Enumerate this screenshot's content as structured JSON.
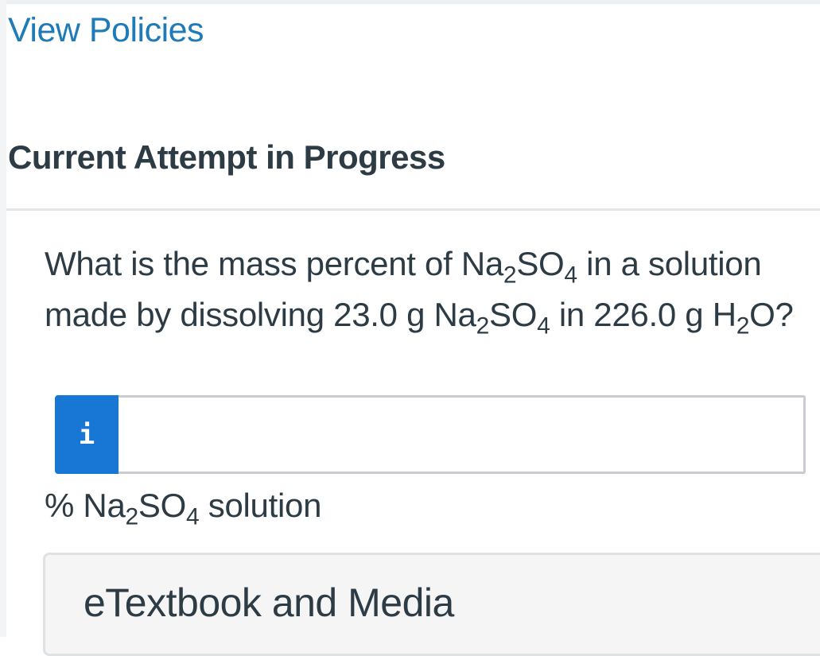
{
  "header": {
    "policies_link": "View Policies",
    "attempt_heading": "Current Attempt in Progress"
  },
  "question": {
    "part1": "What is the mass percent of Na",
    "sub1": "2",
    "part2": "SO",
    "sub2": "4",
    "part3": " in a solution made by dissolving 23.0 g Na",
    "sub3": "2",
    "part4": "SO",
    "sub4": "4",
    "part5": " in 226.0 g H",
    "sub5": "2",
    "part6": "O?"
  },
  "answer": {
    "info_glyph": "i",
    "value": "",
    "placeholder": ""
  },
  "units": {
    "part1": "% Na",
    "sub1": "2",
    "part2": "SO",
    "sub2": "4",
    "part3": " solution"
  },
  "media": {
    "title": "eTextbook and Media"
  },
  "colors": {
    "link": "#1e7bb8",
    "text": "#2d3b45",
    "info_badge": "#1877d4",
    "input_border": "#c9cdd1",
    "panel_background": "#f5f5f5"
  },
  "icons": {
    "info": "info-icon"
  }
}
